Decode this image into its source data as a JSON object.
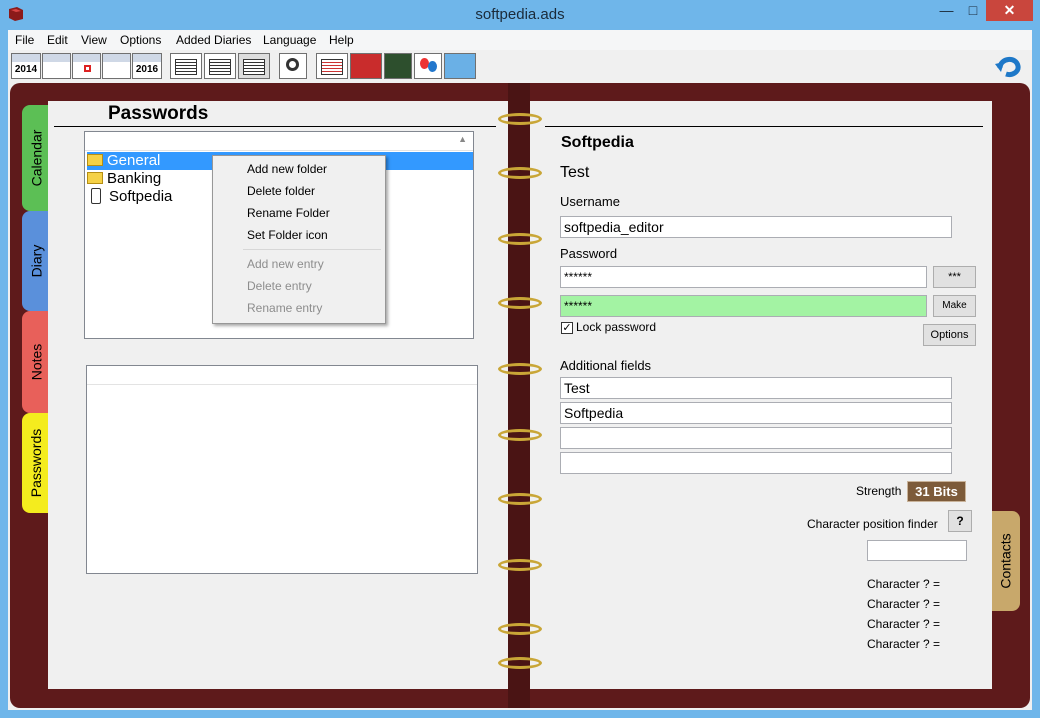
{
  "window": {
    "title": "softpedia.ads"
  },
  "menu": [
    "File",
    "Edit",
    "View",
    "Options",
    "Added Diaries",
    "Language",
    "Help"
  ],
  "toolbar": {
    "year_left": "2014",
    "year_right": "2016"
  },
  "tabs_left": [
    "Calendar",
    "Diary",
    "Notes",
    "Passwords"
  ],
  "tab_right": "Contacts",
  "left_page": {
    "title": "Passwords",
    "tree": [
      "General",
      "Banking",
      "Softpedia"
    ],
    "context_menu": {
      "enabled": [
        "Add new folder",
        "Delete folder",
        "Rename Folder",
        "Set Folder icon"
      ],
      "disabled": [
        "Add new entry",
        "Delete entry",
        "Rename entry"
      ]
    }
  },
  "right_page": {
    "entry_title": "Softpedia",
    "subtitle": "Test",
    "username_label": "Username",
    "username_value": "softpedia_editor",
    "password_label": "Password",
    "password_value": "******",
    "password_repeat": "******",
    "show_button": "***",
    "make_button": "Make",
    "lock_label": "Lock password",
    "options_button": "Options",
    "additional_label": "Additional fields",
    "additional_values": [
      "Test",
      "Softpedia",
      "",
      ""
    ],
    "strength_label": "Strength",
    "strength_value": "31 Bits",
    "char_finder_label": "Character position finder",
    "char_finder_button": "?",
    "characters": [
      "Character ? =",
      "Character ? =",
      "Character ? =",
      "Character ? ="
    ]
  },
  "colors": {
    "titlebar": "#6fb6ea",
    "binder": "#5e1a1b",
    "tab_calendar": "#5cbf55",
    "tab_diary": "#5a90db",
    "tab_notes": "#e8605a",
    "tab_passwords": "#f4ec1e",
    "tab_contacts": "#c8a86b",
    "password_ok": "#a3f3a3",
    "strength_bg": "#7d5b3a"
  }
}
